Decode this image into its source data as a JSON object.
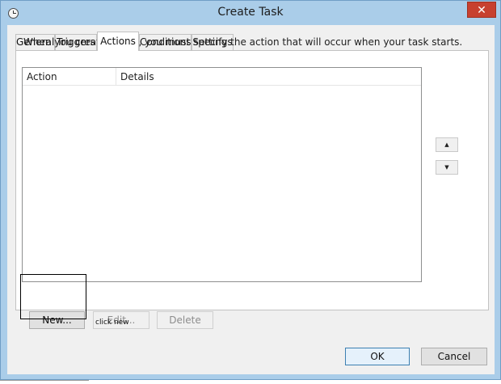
{
  "window": {
    "title": "Create Task",
    "close_glyph": "✕",
    "app_icon": "clock-icon"
  },
  "tabs": [
    {
      "label": "General",
      "active": false
    },
    {
      "label": "Triggers",
      "active": false
    },
    {
      "label": "Actions",
      "active": true
    },
    {
      "label": "Conditions",
      "active": false
    },
    {
      "label": "Settings",
      "active": false
    }
  ],
  "actions_tab": {
    "description": "When you create a task, you must specify the action that will occur when your task starts.",
    "columns": {
      "action": "Action",
      "details": "Details"
    },
    "move_up_glyph": "▲",
    "move_down_glyph": "▼",
    "new_label": "New...",
    "edit_label": "Edit...",
    "delete_label": "Delete"
  },
  "annotation": {
    "note": "click new"
  },
  "dialog": {
    "ok_label": "OK",
    "cancel_label": "Cancel"
  }
}
